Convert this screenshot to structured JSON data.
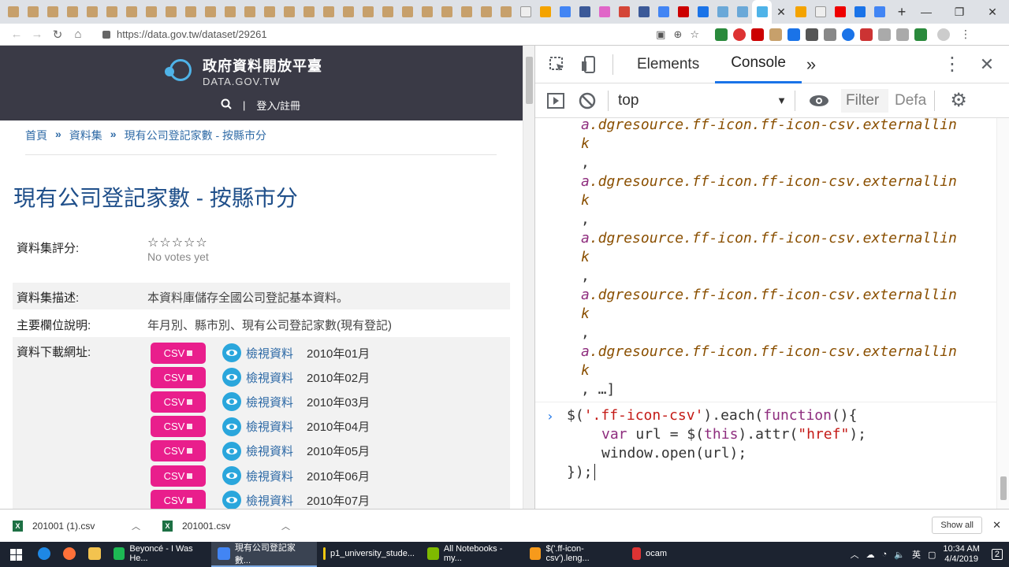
{
  "browser": {
    "url": "https://data.gov.tw/dataset/29261",
    "tab_close": "✕",
    "new_tab": "+",
    "window_controls": {
      "minimize": "—",
      "maximize": "❐",
      "close": "✕"
    }
  },
  "site": {
    "logo_title": "政府資料開放平臺",
    "logo_sub": "DATA.GOV.TW",
    "search_icon": "search-icon",
    "login_label": "登入/註冊",
    "divider": "|"
  },
  "breadcrumb": {
    "home": "首頁",
    "datasets": "資料集",
    "current": "現有公司登記家數 - 按縣市分",
    "sep": "»"
  },
  "dataset": {
    "title": "現有公司登記家數 - 按縣市分",
    "rating_label": "資料集評分:",
    "stars": "☆☆☆☆☆",
    "no_votes": "No votes yet",
    "desc_label": "資料集描述:",
    "desc_value": "本資料庫儲存全國公司登記基本資料。",
    "fields_label": "主要欄位說明:",
    "fields_value": "年月別、縣市別、現有公司登記家數(現有登記)",
    "download_label": "資料下載網址:",
    "csv_label": "CSV",
    "view_label": "檢視資料",
    "downloads": [
      {
        "month": "2010年01月"
      },
      {
        "month": "2010年02月"
      },
      {
        "month": "2010年03月"
      },
      {
        "month": "2010年04月"
      },
      {
        "month": "2010年05月"
      },
      {
        "month": "2010年06月"
      },
      {
        "month": "2010年07月"
      }
    ]
  },
  "devtools": {
    "tabs": {
      "elements": "Elements",
      "console": "Console",
      "more": "»"
    },
    "context": "top",
    "filter_placeholder": "Filter",
    "levels": "Defa",
    "log_lines": [
      "a.dgresource.ff-icon.ff-icon-csv.externallin",
      "k",
      ",",
      "a.dgresource.ff-icon.ff-icon-csv.externallin",
      "k",
      ",",
      "a.dgresource.ff-icon.ff-icon-csv.externallin",
      "k",
      ",",
      "a.dgresource.ff-icon.ff-icon-csv.externallin",
      "k",
      ",",
      "a.dgresource.ff-icon.ff-icon-csv.externallin",
      "k",
      ", …]"
    ],
    "input_prompt": "›",
    "code": {
      "l1_a": "$(",
      "l1_str": "'.ff-icon-csv'",
      "l1_b": ").each(",
      "l1_kw": "function",
      "l1_c": "(){",
      "l2_kw": "var",
      "l2_a": " url = $(",
      "l2_kw2": "this",
      "l2_b": ").attr(",
      "l2_str": "\"href\"",
      "l2_c": ");",
      "l3": "window.open(url);",
      "l4": "});"
    }
  },
  "downloads_bar": {
    "items": [
      {
        "name": "201001 (1).csv"
      },
      {
        "name": "201001.csv"
      }
    ],
    "show_all": "Show all",
    "close": "✕"
  },
  "taskbar": {
    "apps": [
      {
        "label": "Beyoncé - I Was He...",
        "color": "#1db954"
      },
      {
        "label": "現有公司登記家數...",
        "color": "#4285f4"
      },
      {
        "label": "p1_university_stude...",
        "color": "#f2c811"
      },
      {
        "label": "All Notebooks - my...",
        "color": "#7fba00"
      },
      {
        "label": "$('.ff-icon-csv').leng...",
        "color": "#f79a1b"
      },
      {
        "label": "ocam",
        "color": "#d33"
      }
    ],
    "ime": "英",
    "time": "10:34 AM",
    "date": "4/4/2019",
    "notifications": "2"
  }
}
